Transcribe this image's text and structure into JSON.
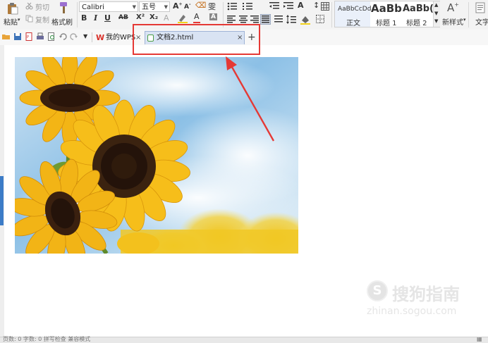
{
  "ribbon": {
    "clipboard": {
      "paste_label": "粘贴",
      "cut_label": "剪切",
      "copy_label": "复制",
      "format_painter_label": "格式刷"
    },
    "font": {
      "family": "Calibri",
      "size": "五号"
    },
    "format_buttons": {
      "bold": "B",
      "italic": "I",
      "underline": "U",
      "strike": "AB",
      "superscript": "X²",
      "subscript": "X₂"
    },
    "styles": [
      {
        "preview": "AaBbCcDd",
        "name": "正文"
      },
      {
        "preview": "AaBb",
        "name": "标题 1"
      },
      {
        "preview": "AaBb(",
        "name": "标题 2"
      }
    ],
    "new_style_label": "新样式",
    "text_tools_label": "文字"
  },
  "tabs": {
    "my_wps": "我的WPS",
    "document": "文档2.html",
    "close_glyph": "×",
    "add_glyph": "+"
  },
  "watermark": {
    "brand": "搜狗指南",
    "url": "zhinan.sogou.com"
  },
  "statusbar": {
    "left_text": "页数: 0  字数: 0  拼写检查  兼容模式"
  },
  "colors": {
    "annotation_red": "#e53935",
    "accent_blue": "#3c7cc7",
    "wps_red": "#d9322b"
  }
}
